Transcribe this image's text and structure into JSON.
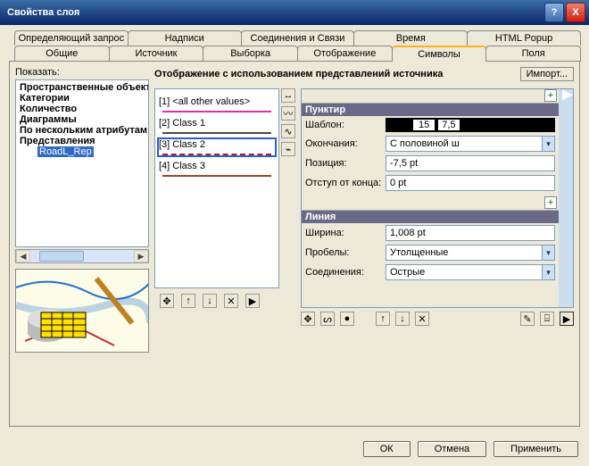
{
  "window": {
    "title": "Свойства слоя"
  },
  "tabs": {
    "row1": [
      "Определяющий запрос",
      "Надписи",
      "Соединения и Связи",
      "Время",
      "HTML Popup"
    ],
    "row2": [
      "Общие",
      "Источник",
      "Выборка",
      "Отображение",
      "Символы",
      "Поля"
    ],
    "active": "Символы"
  },
  "leftPanel": {
    "showLabel": "Показать:",
    "tree": {
      "items": [
        "Пространственные объекты",
        "Категории",
        "Количество",
        "Диаграммы",
        "По нескольким атрибутам",
        "Представления"
      ],
      "subItem": "RoadL_Rep"
    }
  },
  "main": {
    "heading": "Отображение с использованием представлений источника",
    "importBtn": "Импорт..."
  },
  "rules": [
    {
      "label": "[1] <all other values>",
      "color": "#e030a0",
      "style": "solid"
    },
    {
      "label": "[2] Class 1",
      "color": "#4a4a4a",
      "style": "solid"
    },
    {
      "label": "[3] Class 2",
      "color": "#aa2222",
      "style": "dashed",
      "selected": true
    },
    {
      "label": "[4] Class 3",
      "color": "#9a4a20",
      "style": "solid"
    }
  ],
  "ruleToolbar": {
    "move": "✥",
    "up": "↑",
    "down": "↓",
    "del": "✕",
    "play": "▶"
  },
  "props": {
    "section1": {
      "title": "Пунктир",
      "template": {
        "label": "Шаблон:",
        "a": "15",
        "b": "7,5"
      },
      "endings": {
        "label": "Окончания:",
        "value": "С половиной ш"
      },
      "position": {
        "label": "Позиция:",
        "value": "-7,5 pt"
      },
      "offset": {
        "label": "Отступ от конца:",
        "value": "0 pt"
      }
    },
    "section2": {
      "title": "Линия",
      "width": {
        "label": "Ширина:",
        "value": "1,008 pt"
      },
      "gaps": {
        "label": "Пробелы:",
        "value": "Утолщенные"
      },
      "joins": {
        "label": "Соединения:",
        "value": "Острые"
      }
    }
  },
  "buttons": {
    "ok": "ОК",
    "cancel": "Отмена",
    "apply": "Применить"
  },
  "icons": {
    "help": "?",
    "close": "X",
    "leftArrow": "◀",
    "rightArrow": "▶",
    "up": "↑",
    "down": "↓",
    "del": "✕",
    "play": "▶",
    "move": "✥",
    "dropdown": "▾",
    "plus": "+"
  }
}
